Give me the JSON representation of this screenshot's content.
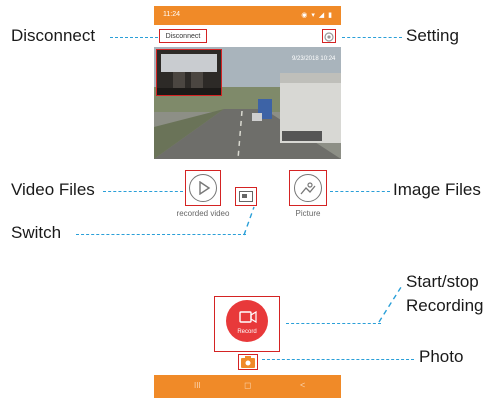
{
  "phone": {
    "status_time": "11:24",
    "status_icons": "◉ ▾ ◢ ▮",
    "disconnect_label": "Disconnect",
    "video_overlay_text": "9/23/2018 10:24",
    "recorded_video_label": "recorded video",
    "picture_label": "Picture",
    "record_label": "Record",
    "nav_keys": [
      "III",
      "◻",
      "<"
    ]
  },
  "callouts": {
    "disconnect": "Disconnect",
    "setting": "Setting",
    "video_files": "Video Files",
    "image_files": "Image Files",
    "switch": "Switch",
    "start_stop_line1": "Start/stop",
    "start_stop_line2": "Recording",
    "photo": "Photo"
  },
  "colors": {
    "accent_orange": "#f08a28",
    "record_red": "#e8393a",
    "highlight_red": "#d42323",
    "leader_blue": "#2a9fd8"
  },
  "icons": [
    "gear-icon",
    "play-icon",
    "switch-icon",
    "image-icon",
    "camcorder-icon",
    "camera-icon"
  ]
}
